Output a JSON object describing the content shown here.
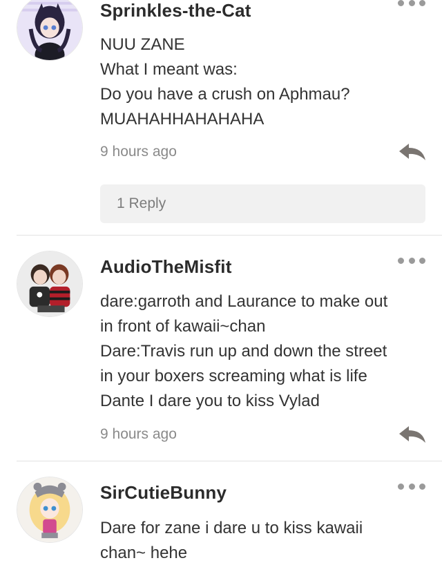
{
  "comments": [
    {
      "username": "Sprinkles-the-Cat",
      "lines": [
        "NUU ZANE",
        "What I meant was:",
        "Do you have a crush on Aphmau?",
        "MUAHAHHAHAHAHA"
      ],
      "time": "9 hours ago",
      "replies_label": "1 Reply"
    },
    {
      "username": "AudioTheMisfit",
      "lines": [
        "dare:garroth and Laurance to make out",
        "in front of kawaii~chan",
        "Dare:Travis run up and down the street",
        "in your boxers screaming what is life",
        "Dante I dare you to kiss Vylad"
      ],
      "time": "9 hours ago"
    },
    {
      "username": "SirCutieBunny",
      "lines": [
        "Dare for zane i dare u to kiss kawaii",
        "chan~ hehe"
      ]
    }
  ],
  "icons": {
    "more": "more-dots-icon",
    "reply": "reply-arrow-icon"
  },
  "colors": {
    "text": "#333333",
    "muted": "#8a8a8a",
    "divider": "#e2e2e2",
    "reply_icon": "#7a7571",
    "replies_bg": "#f1f1f1"
  }
}
